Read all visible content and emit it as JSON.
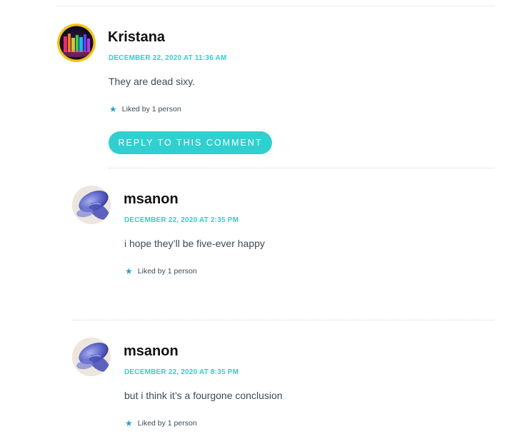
{
  "colors": {
    "accent": "#2fd0cf",
    "text": "#3d4b57",
    "author": "#111111",
    "star": "#2f9fd0",
    "divider": "#d6d6d6"
  },
  "comments": [
    {
      "author": "Kristana",
      "avatar_icon": "colorful-lights-avatar",
      "date": "DECEMBER 22, 2020 AT 11:36 AM",
      "text": "They are dead sixy.",
      "likes": "Liked by 1 person",
      "reply_label": "REPLY TO THIS COMMENT"
    },
    {
      "author": "msanon",
      "avatar_icon": "blue-flower-avatar",
      "date": "DECEMBER 22, 2020 AT 2:35 PM",
      "text": "i hope they’ll be five-ever happy",
      "likes": "Liked by 1 person"
    },
    {
      "author": "msanon",
      "avatar_icon": "blue-flower-avatar",
      "date": "DECEMBER 22, 2020 AT 8:35 PM",
      "text": "but i think it’s a fourgone conclusion",
      "likes": "Liked by 1 person"
    }
  ]
}
